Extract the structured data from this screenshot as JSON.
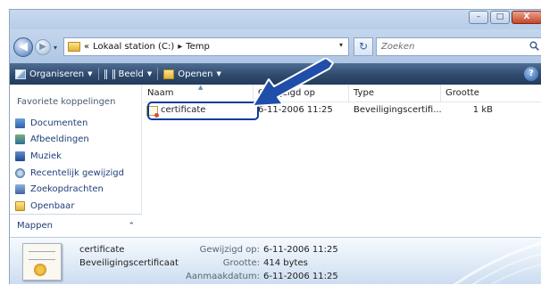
{
  "window": {
    "controls": {
      "minimize": "–",
      "maximize": "□",
      "close": "X"
    }
  },
  "nav": {
    "back_glyph": "◀",
    "forward_glyph": "▶",
    "recent_glyph": "▾"
  },
  "address": {
    "overflow": "«",
    "segments": [
      "Lokaal station (C:)",
      "Temp"
    ],
    "separator": "▸",
    "dropdown_glyph": "▾"
  },
  "search": {
    "placeholder": "Zoeken",
    "refresh_glyph": "↻",
    "icon": "search-icon"
  },
  "toolbar": {
    "organize": "Organiseren",
    "view": "Beeld",
    "open": "Openen",
    "caret": "▼",
    "help": "?"
  },
  "sidebar": {
    "heading": "Favoriete koppelingen",
    "items": [
      {
        "label": "Documenten",
        "icon": "documents-icon"
      },
      {
        "label": "Afbeeldingen",
        "icon": "pictures-icon"
      },
      {
        "label": "Muziek",
        "icon": "music-icon"
      },
      {
        "label": "Recentelijk gewijzigd",
        "icon": "recent-icon"
      },
      {
        "label": "Zoekopdrachten",
        "icon": "searches-icon"
      },
      {
        "label": "Openbaar",
        "icon": "public-folder-icon"
      }
    ],
    "folders_label": "Mappen",
    "folders_caret": "⌃"
  },
  "filelist": {
    "columns": [
      "Naam",
      "Gewijzigd op",
      "Type",
      "Grootte"
    ],
    "sort_caret": "▲",
    "rows": [
      {
        "name": "certificate",
        "modified": "6-11-2006 11:25",
        "type": "Beveiligingscertifi...",
        "size": "1 kB"
      }
    ]
  },
  "details": {
    "name": "certificate",
    "type": "Beveiligingscertificaat",
    "modified_label": "Gewijzigd op:",
    "modified_value": "6-11-2006 11:25",
    "size_label": "Grootte:",
    "size_value": "414 bytes",
    "created_label": "Aanmaakdatum:",
    "created_value": "6-11-2006 11:25"
  },
  "colors": {
    "toolbar": "#2f4a6d",
    "link": "#1d3e78",
    "highlight_border": "#0a3c9a",
    "arrow": "#1f4fa8"
  }
}
